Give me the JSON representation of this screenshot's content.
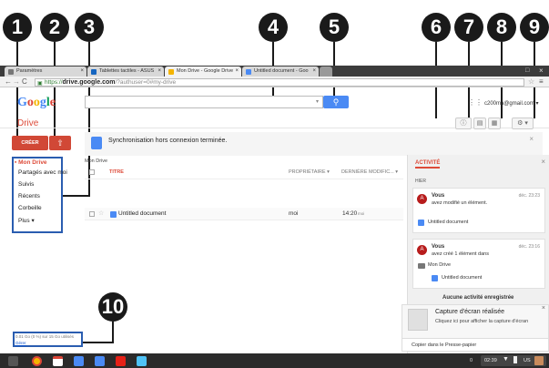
{
  "callouts": [
    "1",
    "2",
    "3",
    "4",
    "5",
    "6",
    "7",
    "8",
    "9",
    "10"
  ],
  "browser": {
    "tabs": [
      {
        "label": "Paramètres",
        "icon": "wrench-icon"
      },
      {
        "label": "Tablettes tactiles - ASUS",
        "icon": "asus-icon"
      },
      {
        "label": "Mon Drive - Google Drive",
        "icon": "drive-icon"
      },
      {
        "label": "Untitled document - Goo",
        "icon": "docs-icon"
      },
      {
        "label": "",
        "icon": "new-tab-icon"
      }
    ],
    "url_scheme": "https://",
    "url_domain": "drive.google.com",
    "url_rest": "/?authuser=0#my-drive"
  },
  "header": {
    "logo": "Google",
    "account": "c200ma@gmail.com ▾",
    "app_title": "Drive"
  },
  "sidebar": {
    "create_label": "CRÉER",
    "items": [
      {
        "label": "Mon Drive",
        "active": true
      },
      {
        "label": "Partagés avec moi"
      },
      {
        "label": "Suivis"
      },
      {
        "label": "Récents"
      },
      {
        "label": "Corbeille"
      },
      {
        "label": "Plus ▾"
      }
    ],
    "storage_text": "0.01 Go (0 %) sur 15 Go utilisés",
    "storage_link": "Gérer"
  },
  "main": {
    "sync_message": "Synchronisation hors connexion terminée.",
    "breadcrumb": "Mon Drive",
    "columns": {
      "title": "TITRE",
      "owner": "PROPRIÉTAIRE",
      "modified": "DERNIÈRE MODIFIC..."
    },
    "files": [
      {
        "name": "Untitled document",
        "owner": "moi",
        "time": "14:20",
        "time_suffix": "moi"
      }
    ]
  },
  "activity": {
    "title": "ACTIVITÉ",
    "section": "HIER",
    "entries": [
      {
        "who": "Vous",
        "date": "déc. 23:23",
        "action": "avez modifié un élément.",
        "items": [
          "Untitled document"
        ]
      },
      {
        "who": "Vous",
        "date": "déc. 23:16",
        "action": "avez créé 1 élément dans",
        "folder": "Mon Drive",
        "items": [
          "Untitled document"
        ]
      }
    ],
    "empty": "Aucune activité enregistrée"
  },
  "notification": {
    "title": "Capture d'écran réalisée",
    "body": "Cliquez ici pour afficher la capture d'écran",
    "footer": "Copier dans le Presse-papier"
  },
  "taskbar": {
    "page_num": "0",
    "time": "02:39",
    "locale": "US"
  },
  "colors": {
    "accent": "#d14836",
    "blue": "#4a8af4",
    "box": "#2a5db0"
  }
}
